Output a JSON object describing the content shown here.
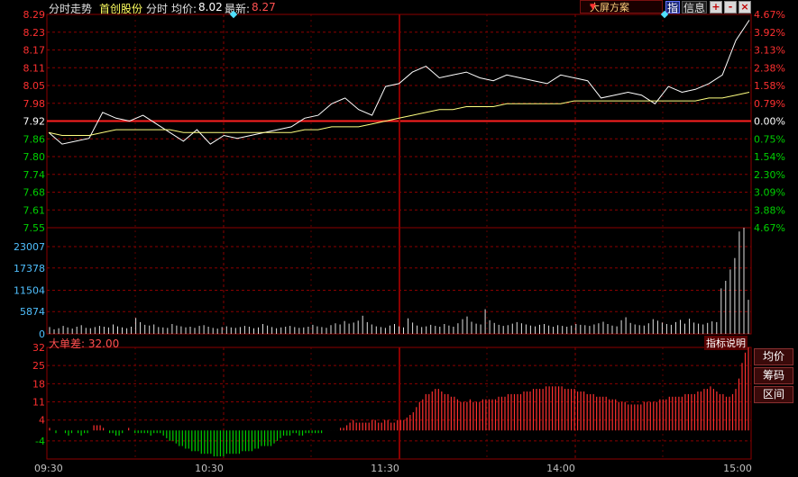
{
  "header": {
    "view_name": "分时走势",
    "stock_name": "首创股份",
    "period": "分时",
    "avg_label": "均价:",
    "avg_value": "8.02",
    "last_label": "最新:",
    "last_value": "8.27",
    "scheme_label": "大屏方案",
    "btn_index": "指",
    "btn_info": "信息",
    "btn_plus": "+",
    "btn_minus": "-",
    "btn_close": "×"
  },
  "indicator": {
    "title": "大单差: 32.00",
    "desc": "指标说明"
  },
  "side_buttons": [
    "均价",
    "筹码",
    "区间"
  ],
  "colors": {
    "grid": "#8b0000",
    "price_line": "#ffffff",
    "avg_line": "#ffff80",
    "up": "#ff3030",
    "down": "#00d000",
    "neutral": "#c0c0c0",
    "volume": "#e0e0e0",
    "volume_axis": "#50c0ff"
  },
  "chart_data": [
    {
      "type": "line",
      "name": "price",
      "x": [
        "09:30",
        "09:32",
        "09:35",
        "09:40",
        "09:45",
        "09:50",
        "09:55",
        "10:00",
        "10:05",
        "10:10",
        "10:15",
        "10:20",
        "10:25",
        "10:30",
        "10:35",
        "10:40",
        "10:45",
        "10:50",
        "10:55",
        "11:00",
        "11:05",
        "11:10",
        "11:15",
        "11:20",
        "11:25",
        "11:30",
        "13:00",
        "13:05",
        "13:10",
        "13:15",
        "13:20",
        "13:25",
        "13:30",
        "13:35",
        "13:40",
        "13:45",
        "13:50",
        "13:55",
        "14:00",
        "14:05",
        "14:10",
        "14:15",
        "14:20",
        "14:25",
        "14:30",
        "14:35",
        "14:40",
        "14:45",
        "14:50",
        "14:53",
        "14:56",
        "14:58",
        "15:00"
      ],
      "price_axis_left": [
        "8.29",
        "8.23",
        "8.17",
        "8.11",
        "8.05",
        "7.98",
        "7.92",
        "7.86",
        "7.80",
        "7.74",
        "7.68",
        "7.61",
        "7.55"
      ],
      "price_axis_right": [
        "4.67%",
        "3.92%",
        "3.13%",
        "2.38%",
        "1.58%",
        "0.79%",
        "0.00%",
        "0.75%",
        "1.54%",
        "2.30%",
        "3.09%",
        "3.88%",
        "4.67%"
      ],
      "ylim": [
        7.55,
        8.29
      ],
      "prev_close": 7.92,
      "series": [
        {
          "name": "price",
          "values": [
            7.88,
            7.84,
            7.85,
            7.86,
            7.95,
            7.93,
            7.92,
            7.94,
            7.91,
            7.88,
            7.85,
            7.89,
            7.84,
            7.87,
            7.86,
            7.87,
            7.88,
            7.89,
            7.9,
            7.93,
            7.94,
            7.98,
            8.0,
            7.96,
            7.94,
            8.04,
            8.05,
            8.09,
            8.11,
            8.07,
            8.08,
            8.09,
            8.07,
            8.06,
            8.08,
            8.07,
            8.06,
            8.05,
            8.08,
            8.07,
            8.06,
            8.0,
            8.01,
            8.02,
            8.01,
            7.98,
            8.04,
            8.02,
            8.03,
            8.05,
            8.08,
            8.2,
            8.27
          ]
        },
        {
          "name": "avg",
          "values": [
            7.88,
            7.87,
            7.87,
            7.87,
            7.88,
            7.89,
            7.89,
            7.89,
            7.89,
            7.89,
            7.88,
            7.88,
            7.88,
            7.88,
            7.88,
            7.88,
            7.88,
            7.88,
            7.88,
            7.89,
            7.89,
            7.9,
            7.9,
            7.9,
            7.91,
            7.92,
            7.93,
            7.94,
            7.95,
            7.96,
            7.96,
            7.97,
            7.97,
            7.97,
            7.98,
            7.98,
            7.98,
            7.98,
            7.98,
            7.99,
            7.99,
            7.99,
            7.99,
            7.99,
            7.99,
            7.99,
            7.99,
            7.99,
            7.99,
            8.0,
            8.0,
            8.01,
            8.02
          ]
        }
      ]
    },
    {
      "type": "bar",
      "name": "volume",
      "axis_ticks": [
        "23007",
        "17378",
        "11504",
        "5874",
        "0"
      ],
      "ylim": [
        0,
        28000
      ],
      "values": [
        1800,
        1200,
        1500,
        2100,
        1700,
        1400,
        1900,
        2300,
        1600,
        1500,
        1800,
        2100,
        1900,
        1700,
        2500,
        2000,
        1700,
        1500,
        1900,
        4200,
        3100,
        2400,
        2200,
        2500,
        1800,
        1700,
        1600,
        2600,
        2200,
        2000,
        1700,
        1900,
        1600,
        2100,
        2300,
        1900,
        1600,
        1400,
        1800,
        2000,
        1700,
        1600,
        1800,
        2100,
        1900,
        1500,
        1700,
        2600,
        2200,
        1800,
        1500,
        1700,
        1900,
        2100,
        1800,
        1600,
        1700,
        1900,
        2400,
        2000,
        1800,
        1600,
        2300,
        2800,
        2500,
        3400,
        2700,
        3000,
        3500,
        4800,
        3100,
        2500,
        2000,
        1800,
        1600,
        2200,
        2600,
        2000,
        1700,
        4100,
        3000,
        2200,
        1800,
        2000,
        2400,
        2100,
        1900,
        2600,
        2200,
        1900,
        2800,
        3900,
        4600,
        3200,
        2700,
        2500,
        6500,
        3600,
        2900,
        2400,
        2100,
        2300,
        2700,
        3100,
        2800,
        2500,
        2200,
        2000,
        2400,
        2600,
        2200,
        1900,
        2300,
        2100,
        1900,
        2200,
        2600,
        2400,
        2300,
        2100,
        2500,
        2800,
        3200,
        2600,
        2200,
        2000,
        3600,
        4400,
        2900,
        2500,
        2300,
        2200,
        2800,
        3900,
        3500,
        3000,
        2600,
        2400,
        3100,
        3700,
        2700,
        4000,
        3000,
        2700,
        2500,
        2900,
        3300,
        3100,
        12000,
        14000,
        17000,
        20000,
        27000,
        28000,
        9000
      ]
    },
    {
      "type": "bar",
      "name": "大单差",
      "axis_ticks": [
        "32",
        "25",
        "18",
        "11",
        "4",
        "-4"
      ],
      "ylim": [
        -11,
        32
      ],
      "values": [
        1,
        0,
        -1,
        0,
        0,
        -1,
        -2,
        -1,
        0,
        -1,
        -2,
        -1,
        -1,
        0,
        2,
        2,
        2,
        1,
        0,
        -1,
        -1,
        -2,
        -2,
        -1,
        0,
        1,
        0,
        -1,
        -1,
        -1,
        -1,
        -1,
        -2,
        -1,
        -1,
        -1,
        -2,
        -3,
        -4,
        -4,
        -5,
        -6,
        -6,
        -7,
        -7,
        -8,
        -8,
        -8,
        -9,
        -9,
        -9,
        -9,
        -10,
        -10,
        -10,
        -10,
        -9,
        -9,
        -9,
        -9,
        -9,
        -8,
        -8,
        -8,
        -8,
        -7,
        -7,
        -6,
        -6,
        -6,
        -6,
        -5,
        -4,
        -3,
        -2,
        -2,
        -2,
        -1,
        -1,
        -2,
        -2,
        -1,
        -1,
        -1,
        -1,
        -1,
        -1,
        0,
        0,
        0,
        0,
        0,
        1,
        1,
        2,
        3,
        4,
        3,
        3,
        3,
        3,
        3,
        4,
        4,
        3,
        3,
        4,
        4,
        3,
        3,
        4,
        4,
        4,
        5,
        6,
        7,
        9,
        11,
        12,
        14,
        14,
        15,
        16,
        16,
        15,
        14,
        14,
        13,
        13,
        12,
        11,
        11,
        11,
        12,
        11,
        11,
        11,
        12,
        12,
        12,
        12,
        12,
        13,
        13,
        13,
        14,
        14,
        14,
        14,
        14,
        15,
        15,
        15,
        16,
        16,
        16,
        16,
        17,
        17,
        17,
        17,
        17,
        17,
        16,
        16,
        16,
        16,
        15,
        15,
        15,
        14,
        14,
        14,
        13,
        13,
        13,
        13,
        12,
        12,
        12,
        11,
        11,
        11,
        10,
        10,
        10,
        10,
        10,
        11,
        11,
        11,
        11,
        11,
        12,
        12,
        12,
        13,
        13,
        13,
        13,
        13,
        14,
        14,
        14,
        14,
        15,
        15,
        16,
        16,
        17,
        16,
        15,
        14,
        14,
        13,
        13,
        14,
        16,
        20,
        26,
        30,
        32
      ]
    }
  ],
  "time_axis": [
    "09:30",
    "10:30",
    "11:30",
    "14:00",
    "15:00"
  ]
}
